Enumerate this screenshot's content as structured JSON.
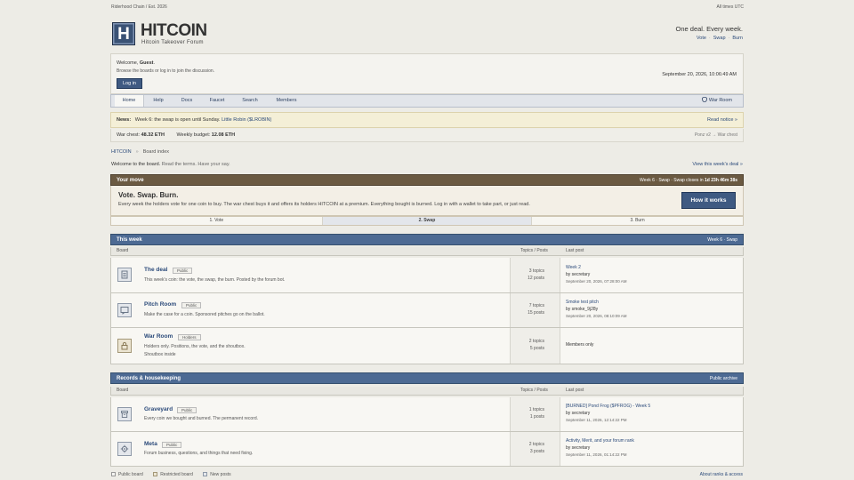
{
  "topbar": {
    "left": "Riderhood Chain / Est. 2026",
    "right": "All times UTC"
  },
  "header": {
    "logo_letter": "H",
    "title": "HITCOIN",
    "subtitle": "Hitcoin Takeover Forum",
    "tagline": "One deal. Every week.",
    "links": [
      "Vote",
      "Swap",
      "Burn"
    ]
  },
  "welcome": {
    "prefix": "Welcome, ",
    "user": "Guest",
    "suffix": ".",
    "note": "Browse the boards or log in to join the discussion.",
    "login_label": "Log in",
    "datetime": "September 20, 2026, 10:06:49 AM"
  },
  "nav": {
    "items": [
      "Home",
      "Help",
      "Docs",
      "Faucet",
      "Search",
      "Members"
    ],
    "war_room": "War Room",
    "colors": {
      "accent": "#3f5a82",
      "brown": "#6b5a42",
      "board_head": "#4d6a93"
    }
  },
  "news": {
    "label": "News:",
    "text": "Week 6: the swap is open until Sunday.",
    "link": "Little Robin ($LROBIN)",
    "read": "Read notice »"
  },
  "warchest": {
    "chest_label": "War chest:",
    "chest_value": "48.32 ETH",
    "budget_label": "Weekly budget:",
    "budget_value": "12.08 ETH",
    "right_a": "Ponz v2",
    "right_sep": "→",
    "right_b": "War chest"
  },
  "breadcrumb": {
    "home": "HITCOIN",
    "sep": "»",
    "current": "Board index"
  },
  "welcome_line": {
    "a": "Welcome to the board.",
    "b": "Read the terms. Have your say.",
    "view": "View this week's deal »"
  },
  "your_move": {
    "head": "Your move",
    "status_prefix": "Week 6 · Swap · Swap closes in ",
    "status_time": "1d 23h 46m 38s",
    "title": "Vote. Swap. Burn.",
    "text": "Every week the holders vote for one coin to buy. The war chest buys it and offers its holders HITCOIN at a premium. Everything bought is burned. Log in with a wallet to take part, or just read.",
    "button": "How it works",
    "steps": [
      "1. Vote",
      "2. Swap",
      "3. Burn"
    ]
  },
  "this_week": {
    "head": "This week",
    "right": "Week 6 · Swap",
    "cols": [
      "Board",
      "Topics / Posts",
      "Last post"
    ],
    "boards": [
      {
        "title": "The deal",
        "badge": "Public",
        "desc": "This week's coin: the vote, the swap, the burn. Posted by the forum bot.",
        "sub": "",
        "topics": "3 topics",
        "posts": "12 posts",
        "last_title": "Week 2",
        "last_by": "by secretary",
        "last_date": "September 20, 2026, 07:28:00 AM",
        "icon": "doc-icon"
      },
      {
        "title": "Pitch Room",
        "badge": "Public",
        "desc": "Make the case for a coin. Sponsored pitches go on the ballot.",
        "sub": "",
        "topics": "7 topics",
        "posts": "15 posts",
        "last_title": "Smoke test pitch",
        "last_by": "by smoke_9j28y",
        "last_date": "September 20, 2026, 08:10:09 AM",
        "icon": "chat-icon"
      },
      {
        "title": "War Room",
        "badge": "Holders",
        "desc": "Holders only. Positions, the vote, and the shoutbox.",
        "sub": "Shoutbox inside",
        "topics": "2 topics",
        "posts": "5 posts",
        "last_title": "Members only",
        "last_by": "",
        "last_date": "",
        "icon": "lock-icon"
      }
    ]
  },
  "records": {
    "head": "Records & housekeeping",
    "right": "Public archive",
    "cols": [
      "Board",
      "Topics / Posts",
      "Last post"
    ],
    "boards": [
      {
        "title": "Graveyard",
        "badge": "Public",
        "desc": "Every coin we bought and burned. The permanent record.",
        "topics": "1 topics",
        "posts": "1 posts",
        "last_title": "[BURNED] Pond Frog ($PFROG) - Week 5",
        "last_by": "by secretary",
        "last_date": "September 11, 2026, 12:14:22 PM",
        "icon": "archive-icon"
      },
      {
        "title": "Meta",
        "badge": "Public",
        "desc": "Forum business, questions, and things that need fixing.",
        "topics": "2 topics",
        "posts": "3 posts",
        "last_title": "Activity, Merit, and your forum rank",
        "last_by": "by secretary",
        "last_date": "September 11, 2026, 01:14:22 PM",
        "icon": "gear-icon"
      }
    ]
  },
  "legend": {
    "items": [
      "Public board",
      "Restricted board",
      "New posts"
    ],
    "about": "About ranks & access"
  }
}
